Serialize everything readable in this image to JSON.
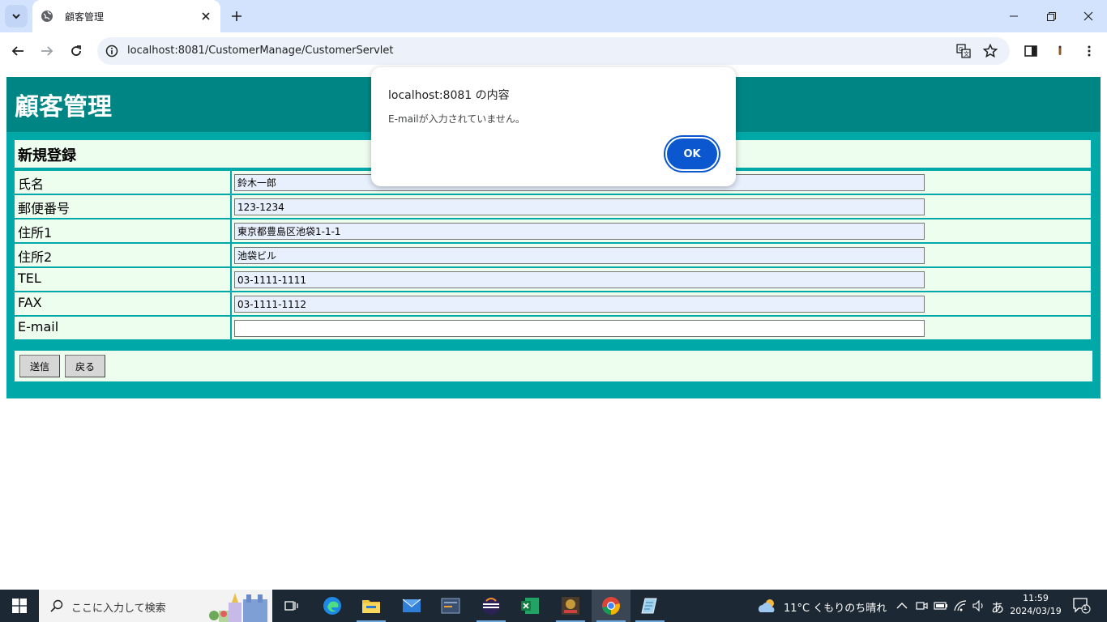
{
  "browser": {
    "tab_title": "顧客管理",
    "url": "localhost:8081/CustomerManage/CustomerServlet"
  },
  "page": {
    "title": "顧客管理",
    "form_heading": "新規登録",
    "fields": [
      {
        "label": "氏名",
        "value": "鈴木一郎"
      },
      {
        "label": "郵便番号",
        "value": "123-1234"
      },
      {
        "label": "住所1",
        "value": "東京都豊島区池袋1-1-1"
      },
      {
        "label": "住所2",
        "value": "池袋ビル"
      },
      {
        "label": "TEL",
        "value": "03-1111-1111"
      },
      {
        "label": "FAX",
        "value": "03-1111-1112"
      },
      {
        "label": "E-mail",
        "value": ""
      }
    ],
    "submit_label": "送信",
    "back_label": "戻る",
    "colors": {
      "header": "#008585",
      "frame": "#00a8a8",
      "cell": "#edfdee"
    }
  },
  "dialog": {
    "title": "localhost:8081 の内容",
    "message": "E-mailが入力されていません。",
    "ok_label": "OK"
  },
  "taskbar": {
    "search_placeholder": "ここに入力して検索",
    "weather": "11°C くもりのち晴れ",
    "ime": "あ",
    "time": "11:59",
    "date": "2024/03/19",
    "notification_count": "1"
  }
}
